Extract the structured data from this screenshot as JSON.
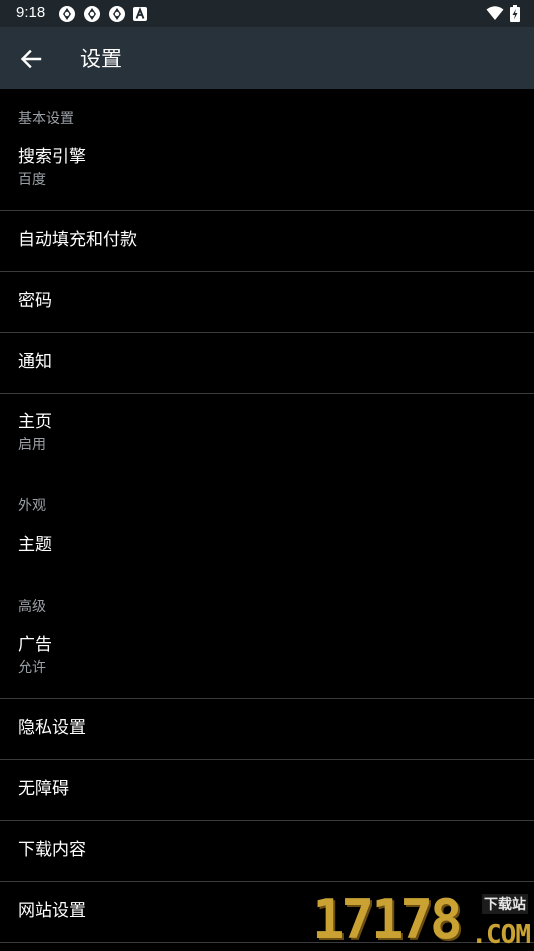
{
  "status_bar": {
    "time": "9:18",
    "left_icons": [
      "sync-icon",
      "sync-icon",
      "sync-icon",
      "font-a-icon"
    ],
    "right_icons": [
      "wifi-icon",
      "battery-charging-icon"
    ]
  },
  "app_bar": {
    "title": "设置",
    "back_icon": "arrow-back-icon"
  },
  "sections": {
    "basic": {
      "header": "基本设置",
      "search_engine": {
        "title": "搜索引擎",
        "summary": "百度"
      },
      "autofill": {
        "title": "自动填充和付款"
      },
      "passwords": {
        "title": "密码"
      },
      "notifications": {
        "title": "通知"
      },
      "homepage": {
        "title": "主页",
        "summary": "启用"
      }
    },
    "appearance": {
      "header": "外观",
      "theme": {
        "title": "主题"
      }
    },
    "advanced": {
      "header": "高级",
      "ads": {
        "title": "广告",
        "summary": "允许"
      },
      "privacy": {
        "title": "隐私设置"
      },
      "accessibility": {
        "title": "无障碍"
      },
      "downloads": {
        "title": "下载内容"
      },
      "site_settings": {
        "title": "网站设置"
      }
    }
  },
  "watermark": {
    "digits": "17178",
    "top_text": "下载站",
    "com_text": ".COM"
  },
  "colors": {
    "status_bar": "#1f272d",
    "app_bar": "#28323a",
    "background": "#000000",
    "secondary_text": "#9aa0a6",
    "divider": "#3a3a3a",
    "watermark_gold": "#c9a233"
  }
}
